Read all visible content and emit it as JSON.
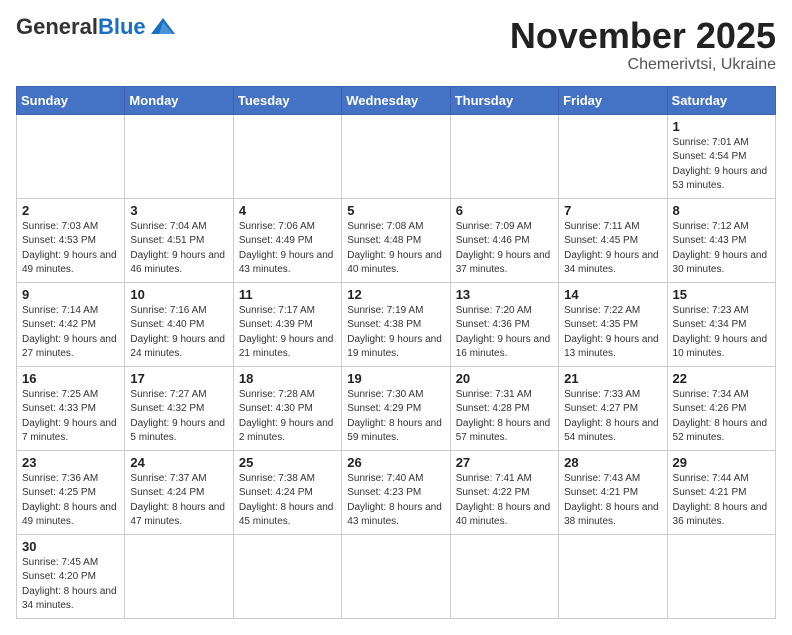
{
  "header": {
    "logo": {
      "general": "General",
      "blue": "Blue"
    },
    "month": "November 2025",
    "location": "Chemerivtsi, Ukraine"
  },
  "weekdays": [
    "Sunday",
    "Monday",
    "Tuesday",
    "Wednesday",
    "Thursday",
    "Friday",
    "Saturday"
  ],
  "weeks": [
    [
      {
        "day": "",
        "info": ""
      },
      {
        "day": "",
        "info": ""
      },
      {
        "day": "",
        "info": ""
      },
      {
        "day": "",
        "info": ""
      },
      {
        "day": "",
        "info": ""
      },
      {
        "day": "",
        "info": ""
      },
      {
        "day": "1",
        "info": "Sunrise: 7:01 AM\nSunset: 4:54 PM\nDaylight: 9 hours and 53 minutes."
      }
    ],
    [
      {
        "day": "2",
        "info": "Sunrise: 7:03 AM\nSunset: 4:53 PM\nDaylight: 9 hours and 49 minutes."
      },
      {
        "day": "3",
        "info": "Sunrise: 7:04 AM\nSunset: 4:51 PM\nDaylight: 9 hours and 46 minutes."
      },
      {
        "day": "4",
        "info": "Sunrise: 7:06 AM\nSunset: 4:49 PM\nDaylight: 9 hours and 43 minutes."
      },
      {
        "day": "5",
        "info": "Sunrise: 7:08 AM\nSunset: 4:48 PM\nDaylight: 9 hours and 40 minutes."
      },
      {
        "day": "6",
        "info": "Sunrise: 7:09 AM\nSunset: 4:46 PM\nDaylight: 9 hours and 37 minutes."
      },
      {
        "day": "7",
        "info": "Sunrise: 7:11 AM\nSunset: 4:45 PM\nDaylight: 9 hours and 34 minutes."
      },
      {
        "day": "8",
        "info": "Sunrise: 7:12 AM\nSunset: 4:43 PM\nDaylight: 9 hours and 30 minutes."
      }
    ],
    [
      {
        "day": "9",
        "info": "Sunrise: 7:14 AM\nSunset: 4:42 PM\nDaylight: 9 hours and 27 minutes."
      },
      {
        "day": "10",
        "info": "Sunrise: 7:16 AM\nSunset: 4:40 PM\nDaylight: 9 hours and 24 minutes."
      },
      {
        "day": "11",
        "info": "Sunrise: 7:17 AM\nSunset: 4:39 PM\nDaylight: 9 hours and 21 minutes."
      },
      {
        "day": "12",
        "info": "Sunrise: 7:19 AM\nSunset: 4:38 PM\nDaylight: 9 hours and 19 minutes."
      },
      {
        "day": "13",
        "info": "Sunrise: 7:20 AM\nSunset: 4:36 PM\nDaylight: 9 hours and 16 minutes."
      },
      {
        "day": "14",
        "info": "Sunrise: 7:22 AM\nSunset: 4:35 PM\nDaylight: 9 hours and 13 minutes."
      },
      {
        "day": "15",
        "info": "Sunrise: 7:23 AM\nSunset: 4:34 PM\nDaylight: 9 hours and 10 minutes."
      }
    ],
    [
      {
        "day": "16",
        "info": "Sunrise: 7:25 AM\nSunset: 4:33 PM\nDaylight: 9 hours and 7 minutes."
      },
      {
        "day": "17",
        "info": "Sunrise: 7:27 AM\nSunset: 4:32 PM\nDaylight: 9 hours and 5 minutes."
      },
      {
        "day": "18",
        "info": "Sunrise: 7:28 AM\nSunset: 4:30 PM\nDaylight: 9 hours and 2 minutes."
      },
      {
        "day": "19",
        "info": "Sunrise: 7:30 AM\nSunset: 4:29 PM\nDaylight: 8 hours and 59 minutes."
      },
      {
        "day": "20",
        "info": "Sunrise: 7:31 AM\nSunset: 4:28 PM\nDaylight: 8 hours and 57 minutes."
      },
      {
        "day": "21",
        "info": "Sunrise: 7:33 AM\nSunset: 4:27 PM\nDaylight: 8 hours and 54 minutes."
      },
      {
        "day": "22",
        "info": "Sunrise: 7:34 AM\nSunset: 4:26 PM\nDaylight: 8 hours and 52 minutes."
      }
    ],
    [
      {
        "day": "23",
        "info": "Sunrise: 7:36 AM\nSunset: 4:25 PM\nDaylight: 8 hours and 49 minutes."
      },
      {
        "day": "24",
        "info": "Sunrise: 7:37 AM\nSunset: 4:24 PM\nDaylight: 8 hours and 47 minutes."
      },
      {
        "day": "25",
        "info": "Sunrise: 7:38 AM\nSunset: 4:24 PM\nDaylight: 8 hours and 45 minutes."
      },
      {
        "day": "26",
        "info": "Sunrise: 7:40 AM\nSunset: 4:23 PM\nDaylight: 8 hours and 43 minutes."
      },
      {
        "day": "27",
        "info": "Sunrise: 7:41 AM\nSunset: 4:22 PM\nDaylight: 8 hours and 40 minutes."
      },
      {
        "day": "28",
        "info": "Sunrise: 7:43 AM\nSunset: 4:21 PM\nDaylight: 8 hours and 38 minutes."
      },
      {
        "day": "29",
        "info": "Sunrise: 7:44 AM\nSunset: 4:21 PM\nDaylight: 8 hours and 36 minutes."
      }
    ],
    [
      {
        "day": "30",
        "info": "Sunrise: 7:45 AM\nSunset: 4:20 PM\nDaylight: 8 hours and 34 minutes."
      },
      {
        "day": "",
        "info": ""
      },
      {
        "day": "",
        "info": ""
      },
      {
        "day": "",
        "info": ""
      },
      {
        "day": "",
        "info": ""
      },
      {
        "day": "",
        "info": ""
      },
      {
        "day": "",
        "info": ""
      }
    ]
  ]
}
